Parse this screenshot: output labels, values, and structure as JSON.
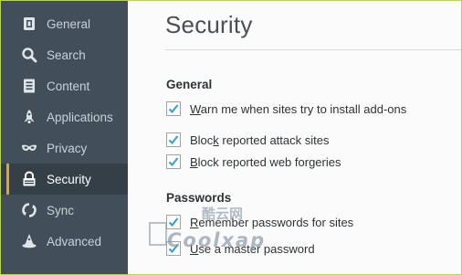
{
  "sidebar": {
    "items": [
      {
        "label": "General",
        "icon": "general-icon"
      },
      {
        "label": "Search",
        "icon": "search-icon"
      },
      {
        "label": "Content",
        "icon": "content-icon"
      },
      {
        "label": "Applications",
        "icon": "rocket-icon"
      },
      {
        "label": "Privacy",
        "icon": "mask-icon"
      },
      {
        "label": "Security",
        "icon": "lock-icon",
        "active": true
      },
      {
        "label": "Sync",
        "icon": "sync-icon"
      },
      {
        "label": "Advanced",
        "icon": "wizard-hat-icon"
      }
    ],
    "active_accent": "#e9a12d",
    "background": "#424f5a"
  },
  "main": {
    "title": "Security",
    "sections": [
      {
        "heading": "General",
        "options": [
          {
            "pre": "",
            "accel": "W",
            "post": "arn me when sites try to install add-ons",
            "checked": true
          },
          {
            "pre": "Bloc",
            "accel": "k",
            "post": " reported attack sites",
            "checked": true
          },
          {
            "pre": "",
            "accel": "B",
            "post": "lock reported web forgeries",
            "checked": true
          }
        ]
      },
      {
        "heading": "Passwords",
        "options": [
          {
            "pre": "",
            "accel": "R",
            "post": "emember passwords for sites",
            "checked": true
          },
          {
            "pre": "",
            "accel": "U",
            "post": "se a master password",
            "checked": true
          }
        ]
      }
    ]
  },
  "watermark": {
    "top": "酷云网",
    "bottom": "Coolxap"
  },
  "colors": {
    "checkmark": "#2a9fd6",
    "frame_border": "#b9d35a"
  }
}
